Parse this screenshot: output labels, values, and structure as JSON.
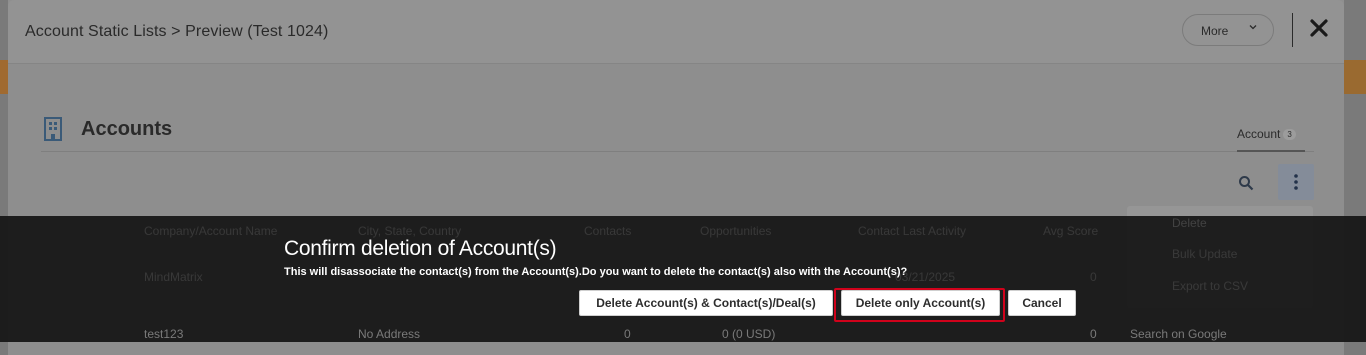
{
  "modal": {
    "title": "Account Static Lists > Preview (Test 1024)",
    "more_label": "More"
  },
  "accounts": {
    "title": "Accounts",
    "tab_label": "Account",
    "tab_count": "3"
  },
  "background_table": {
    "headers": [
      "Company/Account Name",
      "City, State, Country",
      "Contacts",
      "Opportunities",
      "Contact Last Activity",
      "Avg Score"
    ],
    "rows": [
      {
        "name": "MindMatrix",
        "city": "",
        "contacts": "",
        "opportunities": "",
        "last_activity": "03/21/2025",
        "score": "0"
      },
      {
        "name": "test123",
        "city": "No Address",
        "contacts": "0",
        "opportunities": "0 (0 USD)",
        "last_activity": "",
        "score": "0"
      }
    ]
  },
  "dropdown": {
    "items": [
      "Delete",
      "Bulk Update",
      "Export to CSV"
    ],
    "row_action": "Search on Google"
  },
  "dialog": {
    "title": "Confirm deletion of Account(s)",
    "message": "This will disassociate the contact(s) from the Account(s).Do you want to delete the contact(s) also with the Account(s)?",
    "btn_delete_all": "Delete Account(s) & Contact(s)/Deal(s)",
    "btn_delete_only": "Delete only Account(s)",
    "btn_cancel": "Cancel"
  },
  "colors": {
    "focus": "#d0021b",
    "overlay": "#141414"
  }
}
